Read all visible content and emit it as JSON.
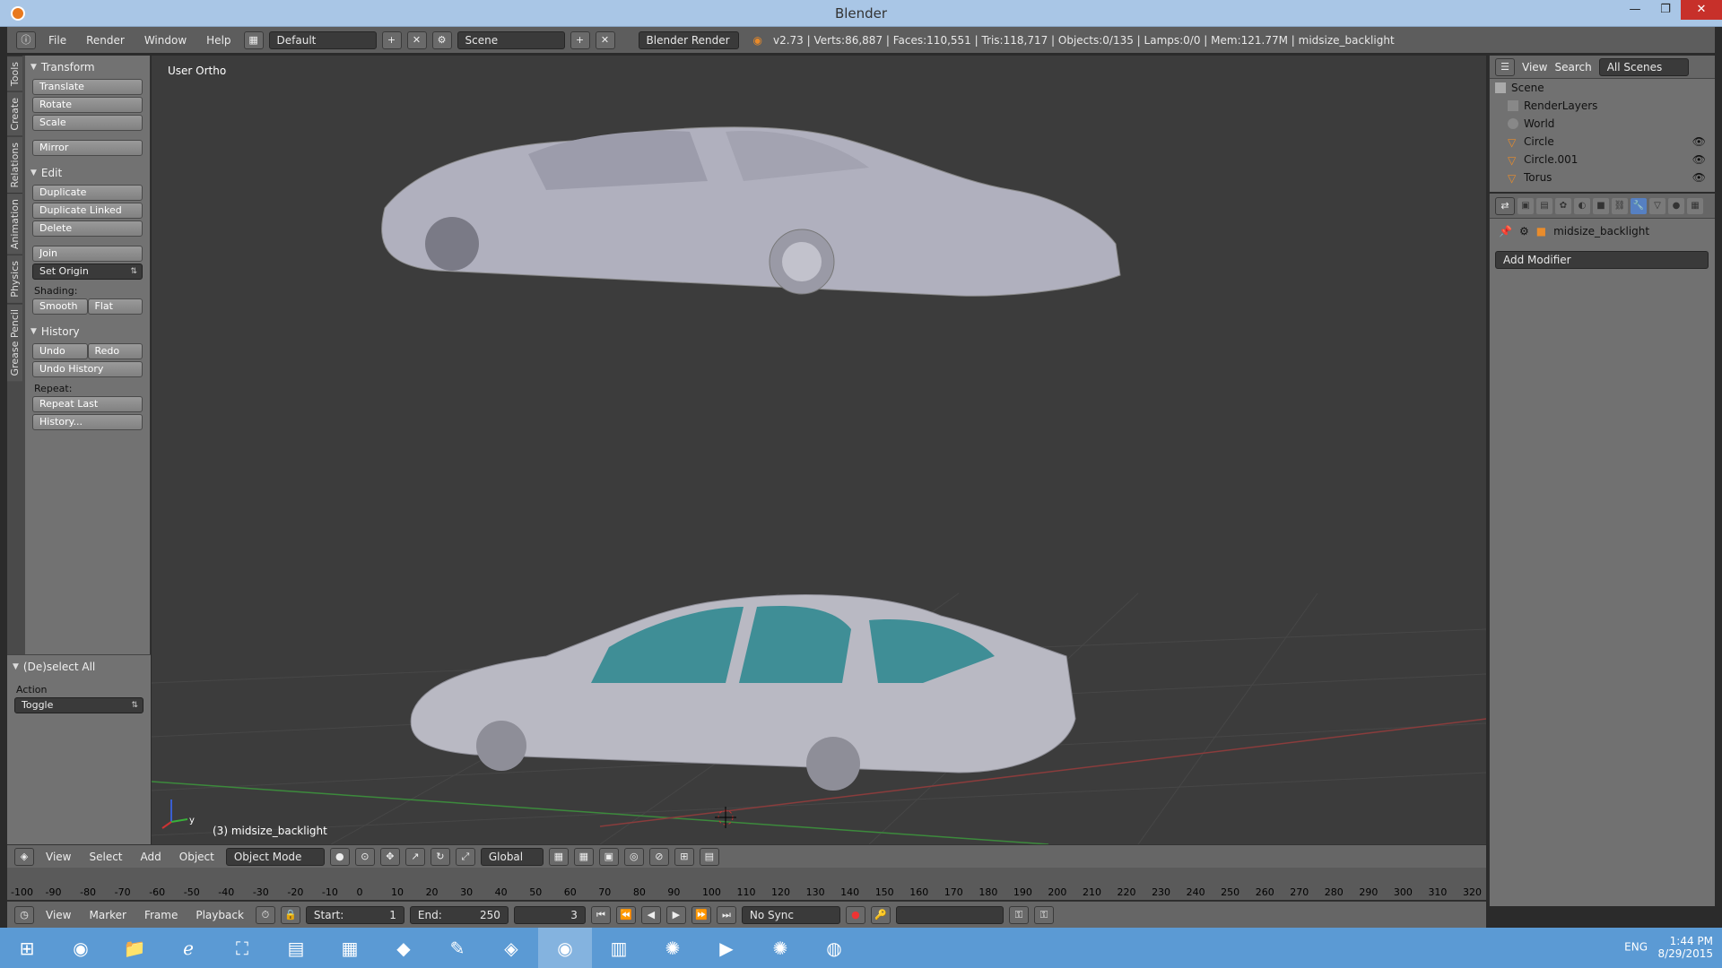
{
  "window": {
    "title": "Blender"
  },
  "window_buttons": [
    "—",
    "❐",
    "✕"
  ],
  "topbar": {
    "menus": [
      "File",
      "Render",
      "Window",
      "Help"
    ],
    "layout": "Default",
    "scene": "Scene",
    "engine": "Blender Render",
    "stats": "v2.73 | Verts:86,887 | Faces:110,551 | Tris:118,717 | Objects:0/135 | Lamps:0/0 | Mem:121.77M | midsize_backlight"
  },
  "tabs_left": [
    "Tools",
    "Create",
    "Relations",
    "Animation",
    "Physics",
    "Grease Pencil"
  ],
  "toolshelf": {
    "transform": {
      "title": "Transform",
      "buttons": [
        "Translate",
        "Rotate",
        "Scale"
      ],
      "mirror": "Mirror"
    },
    "edit": {
      "title": "Edit",
      "buttons": [
        "Duplicate",
        "Duplicate Linked",
        "Delete"
      ],
      "join": "Join",
      "set_origin": "Set Origin",
      "shading_label": "Shading:",
      "smooth": "Smooth",
      "flat": "Flat"
    },
    "history": {
      "title": "History",
      "undo": "Undo",
      "redo": "Redo",
      "undo_history": "Undo History",
      "repeat_label": "Repeat:",
      "repeat_last": "Repeat Last",
      "history_btn": "History..."
    }
  },
  "operator_panel": {
    "title": "(De)select All",
    "action_label": "Action",
    "action_value": "Toggle"
  },
  "viewport": {
    "view_label": "User Ortho",
    "active_object": "(3) midsize_backlight",
    "axis_y": "y"
  },
  "vp_header": {
    "menus": [
      "View",
      "Select",
      "Add",
      "Object"
    ],
    "mode": "Object Mode",
    "orientation": "Global"
  },
  "ruler": [
    "-100",
    "-90",
    "-80",
    "-70",
    "-60",
    "-50",
    "-40",
    "-30",
    "-20",
    "-10",
    "0",
    "10",
    "20",
    "30",
    "40",
    "50",
    "60",
    "70",
    "80",
    "90",
    "100",
    "110",
    "120",
    "130",
    "140",
    "150",
    "160",
    "170",
    "180",
    "190",
    "200",
    "210",
    "220",
    "230",
    "240",
    "250",
    "260",
    "270",
    "280",
    "290",
    "300",
    "310",
    "320"
  ],
  "timeline_bar": {
    "menus": [
      "View",
      "Marker",
      "Frame",
      "Playback"
    ],
    "start_label": "Start:",
    "start_value": "1",
    "end_label": "End:",
    "end_value": "250",
    "current_frame": "3",
    "sync": "No Sync"
  },
  "outliner": {
    "header": {
      "view": "View",
      "search": "Search",
      "filter": "All Scenes"
    },
    "rows": [
      "Scene",
      "RenderLayers",
      "World",
      "Circle",
      "Circle.001",
      "Torus"
    ]
  },
  "properties": {
    "object_name": "midsize_backlight",
    "add_modifier": "Add Modifier"
  },
  "taskbar": {
    "lang": "ENG",
    "time": "1:44 PM",
    "date": "8/29/2015"
  },
  "colors": {
    "accent": "#5680c2",
    "titlebar": "#a9c6e6",
    "taskbar": "#5b9ad4",
    "glass": "#3f8e96"
  }
}
